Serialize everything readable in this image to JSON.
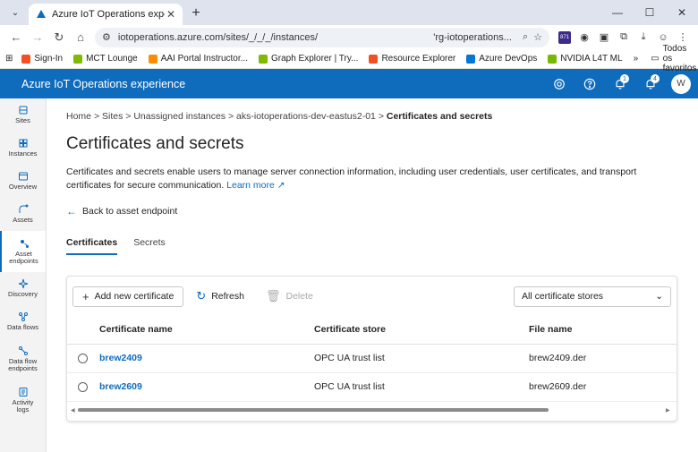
{
  "browser": {
    "tab_title": "Azure IoT Operations experienc",
    "url": "iotoperations.azure.com/sites/_/_/_/instances/",
    "url_tail": "'rg-iotoperations...",
    "ext_badge": "871",
    "bookmarks": [
      {
        "label": "Sign-In",
        "color": "#f25022"
      },
      {
        "label": "MCT Lounge",
        "color": "#7fba00"
      },
      {
        "label": "AAI Portal Instructor...",
        "color": "#ff8c00"
      },
      {
        "label": "Graph Explorer | Try...",
        "color": "#7fba00"
      },
      {
        "label": "Resource Explorer",
        "color": "#f25022"
      },
      {
        "label": "Azure DevOps",
        "color": "#0078d4"
      },
      {
        "label": "NVIDIA L4T ML",
        "color": "#76b900"
      }
    ],
    "bookmarks_more": "»",
    "all_bookmarks": "Todos os favoritos"
  },
  "app": {
    "title": "Azure IoT Operations experience",
    "notif_badge_1": "1",
    "notif_badge_2": "4",
    "avatar_initial": "W"
  },
  "sidebar": {
    "items": [
      {
        "label": "Sites"
      },
      {
        "label": "Instances"
      },
      {
        "label": "Overview"
      },
      {
        "label": "Assets"
      },
      {
        "label": "Asset endpoints"
      },
      {
        "label": "Discovery"
      },
      {
        "label": "Data flows"
      },
      {
        "label": "Data flow endpoints"
      },
      {
        "label": "Activity logs"
      }
    ]
  },
  "breadcrumb": {
    "items": [
      "Home",
      "Sites",
      "Unassigned instances",
      "aks-iotoperations-dev-eastus2-01"
    ],
    "current": "Certificates and secrets",
    "sep": ">"
  },
  "page": {
    "title": "Certificates and secrets",
    "description": "Certificates and secrets enable users to manage server connection information, including user credentials, user certificates, and transport certificates for secure communication.",
    "learn_more": "Learn more",
    "back_label": "Back to asset endpoint",
    "tabs": [
      "Certificates",
      "Secrets"
    ]
  },
  "commands": {
    "add": "Add new certificate",
    "refresh": "Refresh",
    "delete": "Delete",
    "store_filter": "All certificate stores"
  },
  "table": {
    "columns": [
      "Certificate name",
      "Certificate store",
      "File name"
    ],
    "rows": [
      {
        "name": "brew2409",
        "store": "OPC UA trust list",
        "file": "brew2409.der"
      },
      {
        "name": "brew2609",
        "store": "OPC UA trust list",
        "file": "brew2609.der"
      }
    ]
  },
  "colors": {
    "accent": "#0f6cbd"
  }
}
